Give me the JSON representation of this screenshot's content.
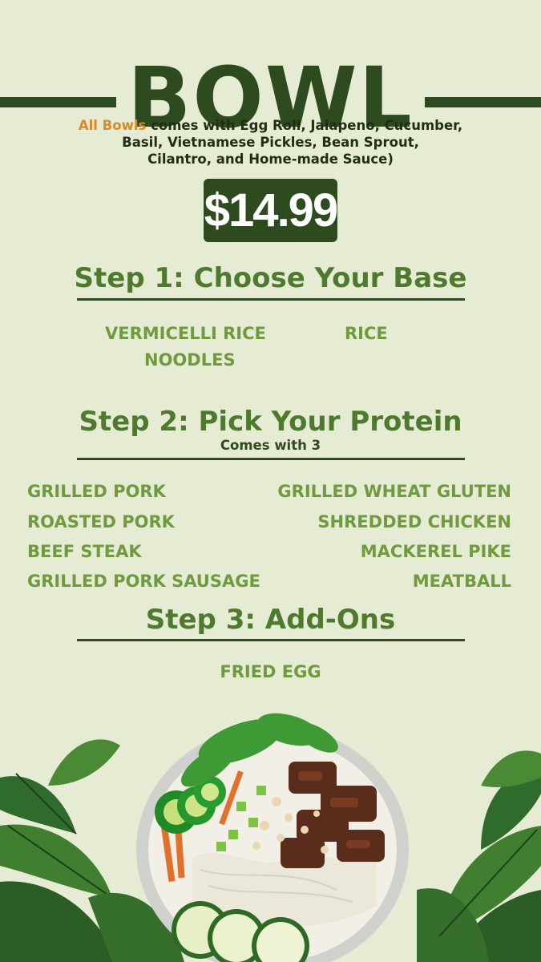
{
  "title": "BOWL",
  "description": {
    "accent": "All Bowls",
    "line1": " comes with Egg Roll, Jalapeno, Cucumber,",
    "line2": "Basil, Vietnamese Pickles, Bean Sprout,",
    "line3": "Cilantro, and Home-made Sauce)"
  },
  "price": "$14.99",
  "step1": {
    "title": "Step 1: Choose Your Base",
    "items": [
      "VERMICELLI RICE",
      "NOODLES",
      "RICE"
    ]
  },
  "step2": {
    "title": "Step 2: Pick Your Protein",
    "subtitle": "Comes with 3",
    "left_items": [
      "GRILLED PORK",
      "ROASTED PORK",
      "BEEF STEAK",
      "GRILLED PORK SAUSAGE"
    ],
    "right_items": [
      "GRILLED WHEAT GLUTEN",
      "SHREDDED CHICKEN",
      "MACKEREL PIKE",
      "MEATBALL"
    ]
  },
  "step3": {
    "title": "Step 3: Add-Ons",
    "items": [
      "FRIED EGG"
    ]
  },
  "colors": {
    "background": "#e6ebd3",
    "dark_green": "#2e4a1f",
    "heading_green": "#4e7a2e",
    "item_green": "#6f9a3e",
    "accent_orange": "#d68a2a"
  }
}
